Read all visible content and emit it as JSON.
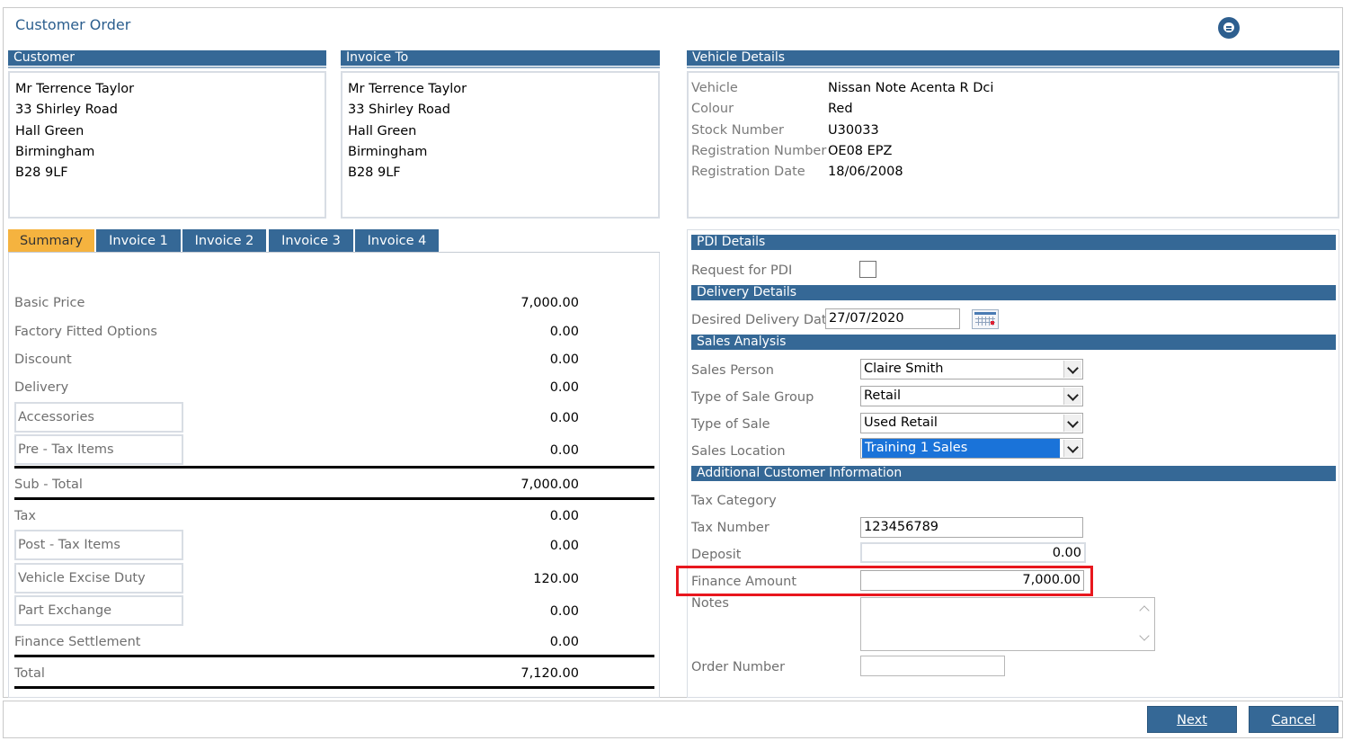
{
  "window": {
    "title": "Customer Order"
  },
  "icons": {
    "chat": "chat-bubble-icon",
    "calendar": "calendar-icon"
  },
  "colors": {
    "header": "#356896",
    "active_tab": "#f5b33f",
    "highlight_border": "#e8171e",
    "title": "#2b5e8e"
  },
  "customer": {
    "header": "Customer",
    "lines": [
      "Mr Terrence Taylor",
      "33 Shirley Road",
      "Hall Green",
      "Birmingham",
      "B28 9LF"
    ]
  },
  "invoice_to": {
    "header": "Invoice To",
    "lines": [
      "Mr Terrence Taylor",
      "33 Shirley Road",
      "Hall Green",
      "Birmingham",
      "B28 9LF"
    ]
  },
  "vehicle": {
    "header": "Vehicle Details",
    "rows": [
      {
        "label": "Vehicle",
        "value": "Nissan Note Acenta R Dci"
      },
      {
        "label": "Colour",
        "value": "Red"
      },
      {
        "label": "Stock Number",
        "value": "U30033"
      },
      {
        "label": "Registration Number",
        "value": "OE08 EPZ"
      },
      {
        "label": "Registration Date",
        "value": "18/06/2008"
      }
    ]
  },
  "tabs": [
    {
      "label": "Summary",
      "active": true
    },
    {
      "label": "Invoice 1"
    },
    {
      "label": "Invoice 2"
    },
    {
      "label": "Invoice 3"
    },
    {
      "label": "Invoice 4"
    }
  ],
  "summary": {
    "basic_price": {
      "label": "Basic Price",
      "value": "7,000.00"
    },
    "factory_options": {
      "label": "Factory Fitted Options",
      "value": "0.00"
    },
    "discount": {
      "label": "Discount",
      "value": "0.00"
    },
    "delivery": {
      "label": "Delivery",
      "value": "0.00"
    },
    "accessories": {
      "label": "Accessories",
      "value": "0.00"
    },
    "pre_tax": {
      "label": "Pre - Tax Items",
      "value": "0.00"
    },
    "sub_total": {
      "label": "Sub - Total",
      "value": "7,000.00"
    },
    "tax": {
      "label": "Tax",
      "value": "0.00"
    },
    "post_tax": {
      "label": "Post - Tax Items",
      "value": "0.00"
    },
    "excise": {
      "label": "Vehicle Excise Duty",
      "value": "120.00"
    },
    "part_exchange": {
      "label": "Part Exchange",
      "value": "0.00"
    },
    "finance_settlement": {
      "label": "Finance Settlement",
      "value": "0.00"
    },
    "total": {
      "label": "Total",
      "value": "7,120.00"
    }
  },
  "pdi": {
    "header": "PDI Details",
    "request_label": "Request for PDI",
    "request_checked": false
  },
  "delivery": {
    "header": "Delivery Details",
    "date_label": "Desired Delivery Date",
    "date_value": "27/07/2020"
  },
  "sales": {
    "header": "Sales Analysis",
    "person": {
      "label": "Sales Person",
      "value": "Claire Smith"
    },
    "group": {
      "label": "Type of Sale Group",
      "value": "Retail"
    },
    "type": {
      "label": "Type of Sale",
      "value": "Used Retail"
    },
    "location": {
      "label": "Sales Location",
      "value": "Training 1 Sales"
    }
  },
  "additional": {
    "header": "Additional Customer Information",
    "tax_category_label": "Tax Category",
    "tax_number_label": "Tax Number",
    "tax_number_value": "123456789",
    "deposit_label": "Deposit",
    "deposit_value": "0.00",
    "finance_label": "Finance Amount",
    "finance_value": "7,000.00",
    "notes_label": "Notes",
    "notes_value": "",
    "order_number_label": "Order Number",
    "order_number_value": ""
  },
  "buttons": {
    "next": "Next",
    "cancel": "Cancel"
  }
}
